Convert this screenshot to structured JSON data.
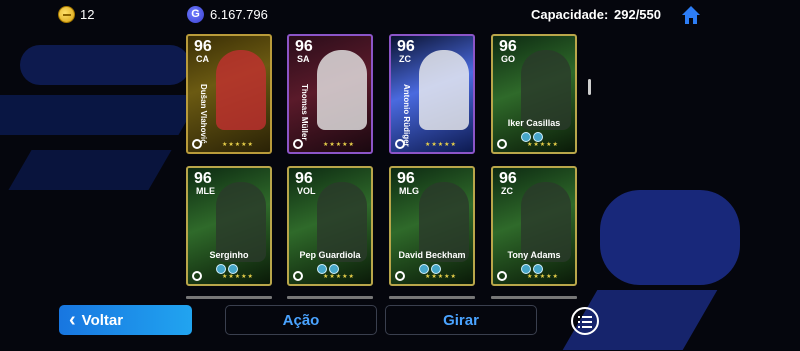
{
  "topbar": {
    "coins": "12",
    "gp": "6.167.796",
    "gp_icon_letter": "G",
    "capacity_label": "Capacidade:",
    "capacity_value": "292/550",
    "home_icon": "home-icon"
  },
  "cards": [
    {
      "rating": "96",
      "position": "CA",
      "name": "Dušan Vlahović",
      "style": "gold",
      "name_orientation": "vertical",
      "stars": "★★★★★"
    },
    {
      "rating": "96",
      "position": "SA",
      "name": "Thomas Müller",
      "style": "red",
      "name_orientation": "vertical",
      "stars": "★★★★★"
    },
    {
      "rating": "96",
      "position": "ZC",
      "name": "Antonio Rüdiger",
      "style": "blue",
      "name_orientation": "vertical",
      "stars": "★★★★★"
    },
    {
      "rating": "96",
      "position": "GO",
      "name": "Iker Casillas",
      "style": "green",
      "name_orientation": "horizontal",
      "stars": "★★★★★"
    },
    {
      "rating": "96",
      "position": "MLE",
      "name": "Serginho",
      "style": "green",
      "name_orientation": "horizontal",
      "stars": "★★★★★"
    },
    {
      "rating": "96",
      "position": "VOL",
      "name": "Pep Guardiola",
      "style": "green",
      "name_orientation": "horizontal",
      "stars": "★★★★★"
    },
    {
      "rating": "96",
      "position": "MLG",
      "name": "David Beckham",
      "style": "green",
      "name_orientation": "horizontal",
      "stars": "★★★★★"
    },
    {
      "rating": "96",
      "position": "ZC",
      "name": "Tony Adams",
      "style": "green",
      "name_orientation": "horizontal",
      "stars": "★★★★★"
    }
  ],
  "buttons": {
    "voltar": "Voltar",
    "acao": "Ação",
    "girar": "Girar",
    "menu_icon": "list-menu-icon"
  }
}
